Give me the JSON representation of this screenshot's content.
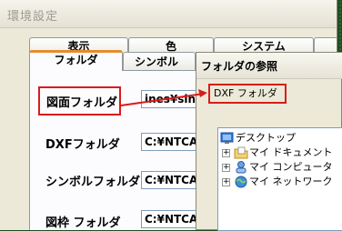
{
  "main_dialog": {
    "title": "環境設定",
    "tabs_back": [
      "表示",
      "色",
      "システム"
    ],
    "tabs_front": [
      "フォルダ",
      "シンボル"
    ],
    "rows": [
      {
        "label": "図面フォルダ",
        "value": "ines¥sin"
      },
      {
        "label": "DXFフォルダ",
        "value": "C:¥NTCA"
      },
      {
        "label": "シンボルフォルダ",
        "value": "C:¥NTCA"
      },
      {
        "label": "図枠 フォルダ",
        "value": "C:¥NTCA"
      }
    ]
  },
  "browse_dialog": {
    "title": "フォルダの参照",
    "message": "DXF フォルダ",
    "tree": [
      {
        "label": "デスクトップ",
        "icon": "desktop-icon",
        "expander": ""
      },
      {
        "label": "マイ ドキュメント",
        "icon": "my-documents-icon",
        "expander": "+"
      },
      {
        "label": "マイ コンピュータ",
        "icon": "my-computer-icon",
        "expander": "+"
      },
      {
        "label": "マイ ネットワーク",
        "icon": "my-network-icon",
        "expander": "+"
      }
    ]
  },
  "colors": {
    "annotation_red": "#d81c1c",
    "active_tab_accent": "#e68b2c",
    "background_green": "#1f4d22"
  }
}
